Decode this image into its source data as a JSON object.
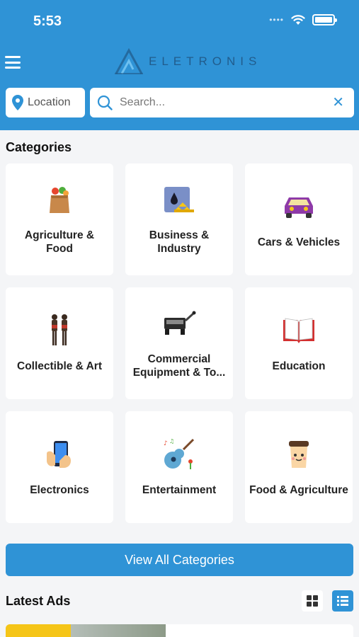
{
  "status_bar": {
    "time": "5:53"
  },
  "app": {
    "logo_text": "ELETRONIS"
  },
  "location": {
    "label": "Location"
  },
  "search": {
    "placeholder": "Search...",
    "value": ""
  },
  "categories": {
    "title": "Categories",
    "items": [
      {
        "name": "Agriculture & Food",
        "icon": "grocery-bag-icon"
      },
      {
        "name": "Business & Industry",
        "icon": "oil-gold-icon"
      },
      {
        "name": "Cars & Vehicles",
        "icon": "car-icon"
      },
      {
        "name": "Collectible & Art",
        "icon": "statues-icon"
      },
      {
        "name": "Commercial Equipment & To...",
        "icon": "equipment-machine-icon"
      },
      {
        "name": "Education",
        "icon": "book-icon"
      },
      {
        "name": "Electronics",
        "icon": "smartphone-icon"
      },
      {
        "name": "Entertainment",
        "icon": "guitar-icon"
      },
      {
        "name": "Food & Agriculture",
        "icon": "coffee-cup-icon"
      }
    ],
    "view_all_label": "View All Categories"
  },
  "latest_ads": {
    "title": "Latest Ads",
    "view_mode": "list"
  },
  "colors": {
    "primary": "#2f93d6",
    "background": "#f4f5f7"
  }
}
